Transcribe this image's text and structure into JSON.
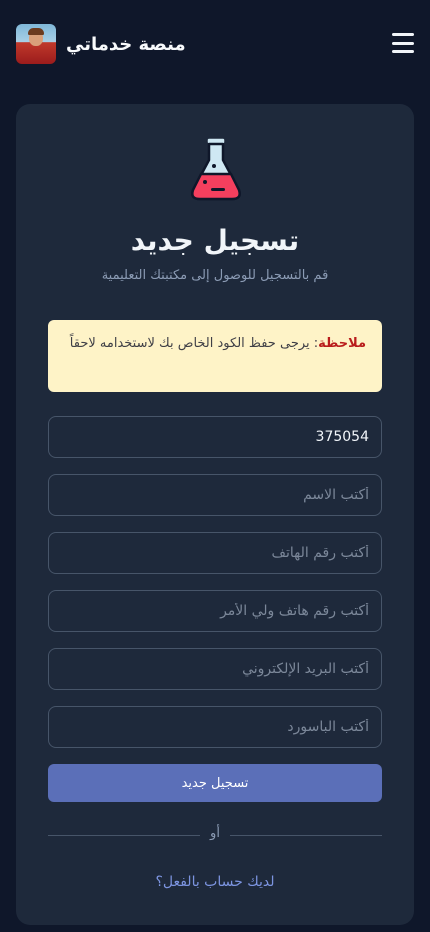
{
  "header": {
    "brand_name": "منصة خدماتي",
    "menu_icon": "hamburger-icon",
    "avatar_icon": "user-avatar"
  },
  "form": {
    "icon": "flask-icon",
    "title": "تسجيل جديد",
    "subtitle": "قم بالتسجيل للوصول إلى مكتبتك التعليمية",
    "note_label": "ملاحظة",
    "note_text": ": يرجى حفظ الكود الخاص بك لاستخدامه لاحقاً",
    "code_value": "375054",
    "name_placeholder": "أكتب الاسم",
    "phone_placeholder": "أكتب رقم الهاتف",
    "parent_phone_placeholder": "أكتب رقم هاتف ولي الأمر",
    "email_placeholder": "أكتب البريد الإلكتروني",
    "password_placeholder": "أكتب الباسورد",
    "submit_label": "تسجيل جديد",
    "or_label": "أو",
    "login_link": "لديك حساب بالفعل؟"
  },
  "colors": {
    "background": "#0f172a",
    "card": "#1e293b",
    "accent": "#5b6fb8",
    "note_bg": "#fef3c7",
    "note_label": "#b91c1c",
    "link": "#7c94e0"
  }
}
